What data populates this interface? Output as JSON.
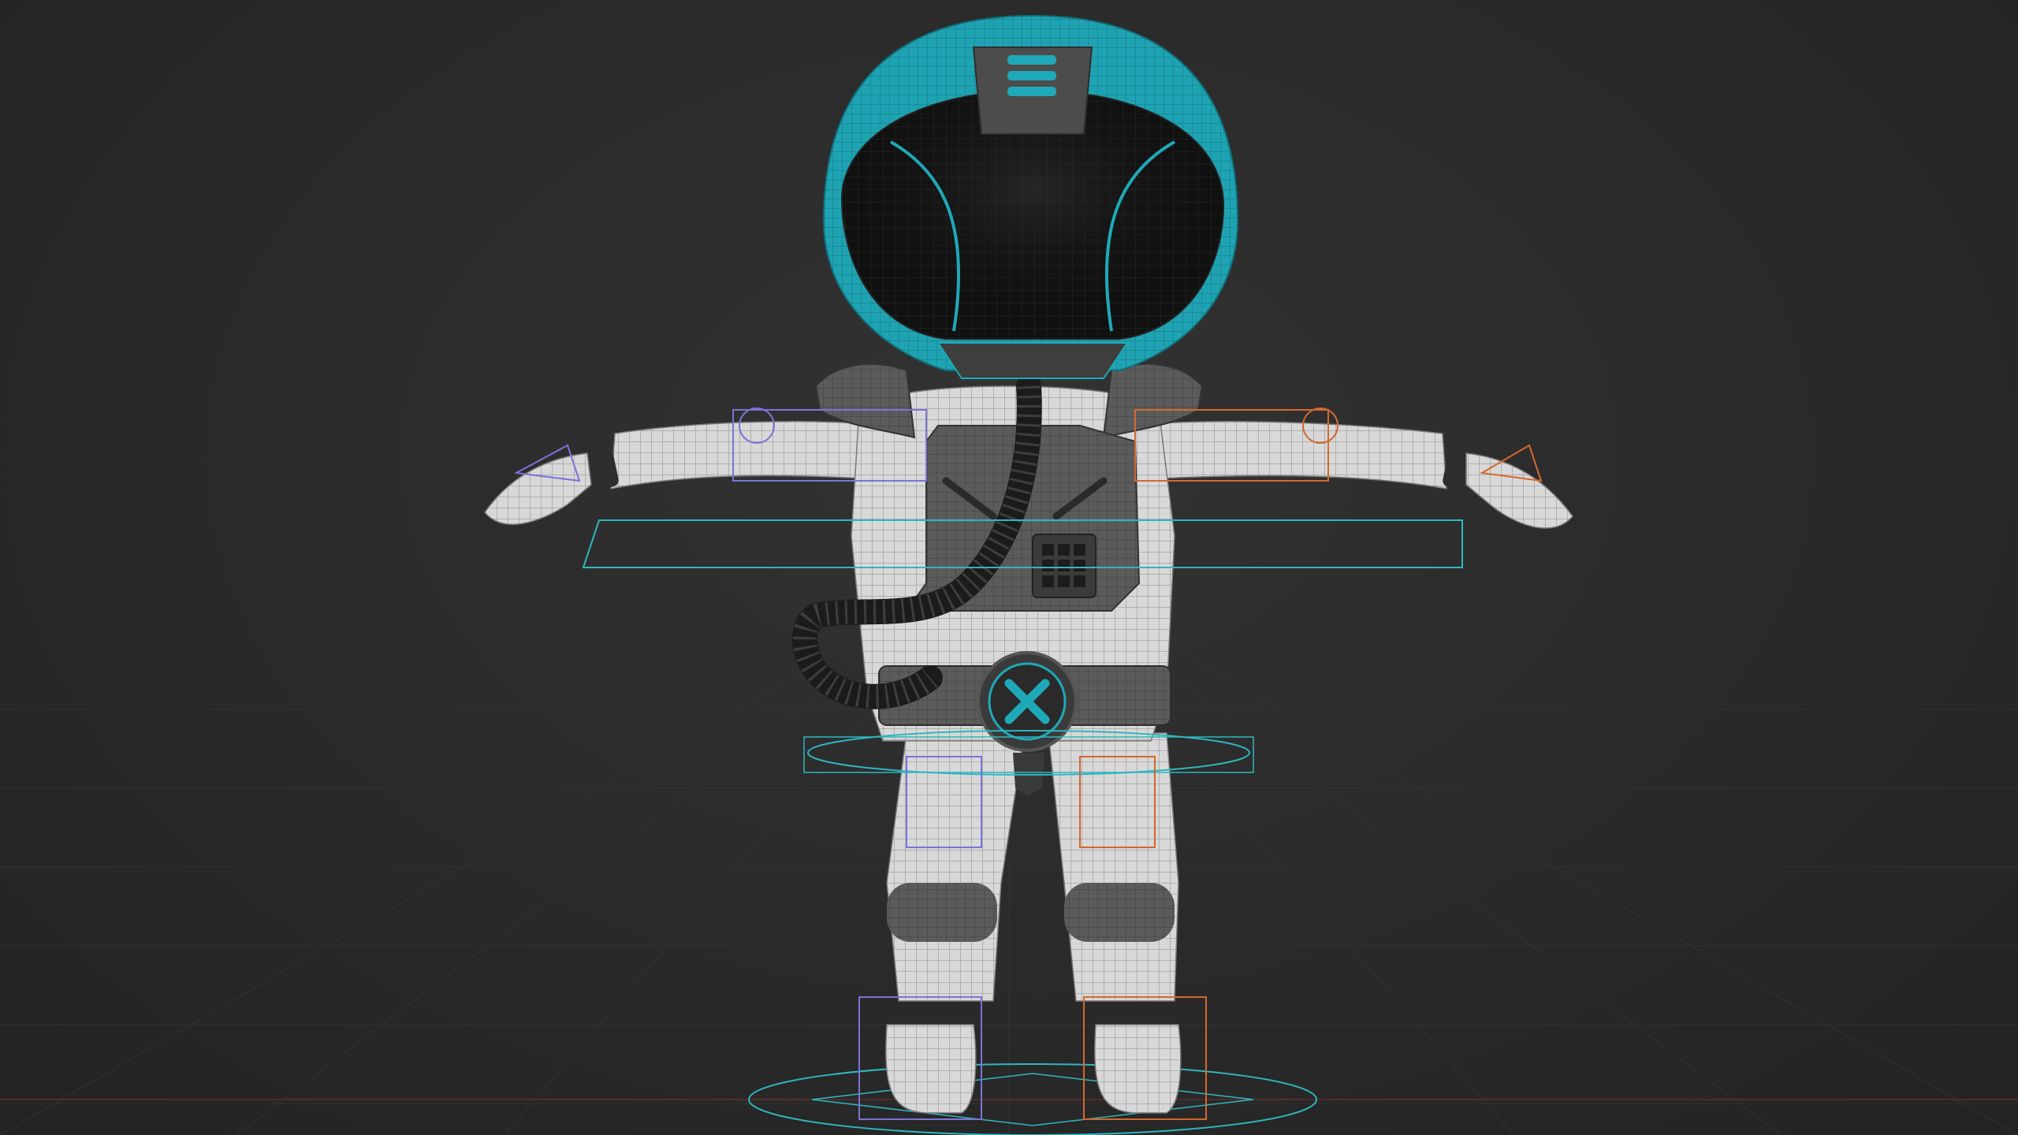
{
  "scene": {
    "subject": "astronaut-character-model",
    "view": "front-orthographic",
    "pose": "t-pose",
    "shading": "wireframe-overlay"
  },
  "colors": {
    "background": "#2a2a2a",
    "grid": "#3a3a3a",
    "suit": "#d6d6d6",
    "suit_dark": "#8e8e8e",
    "helmet_accent": "#1fa9b8",
    "visor": "#0d0d0d",
    "armor": "#5d5d5d",
    "hose": "#1b1b1b",
    "rig_left": "#7b74d6",
    "rig_right": "#d3682e",
    "rig_center": "#2fb6c0"
  },
  "icons": {
    "belt_buckle": "x-emblem-icon",
    "chest_panel": "keypad-icon"
  }
}
